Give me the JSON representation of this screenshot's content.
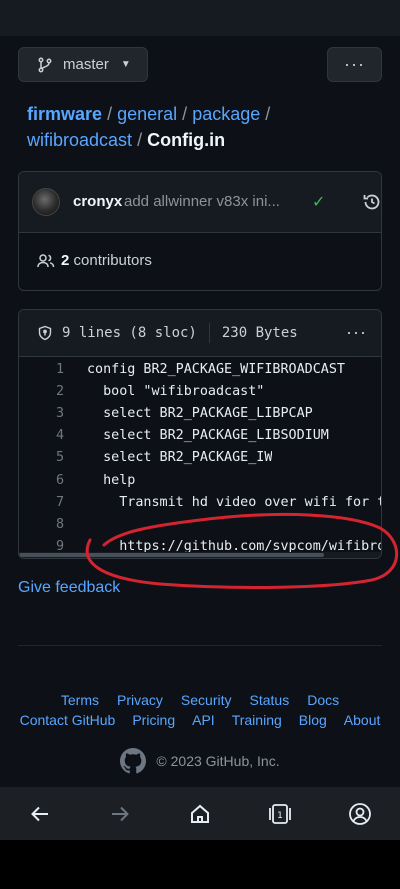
{
  "branch": {
    "name": "master"
  },
  "breadcrumb": {
    "repo": "firmware",
    "dir1": "general",
    "dir2": "package",
    "dir3": "wifibroadcast",
    "file": "Config.in",
    "sep": "/"
  },
  "commit": {
    "author": "cronyx",
    "message": "add allwinner v83x ini...",
    "status": "success"
  },
  "contributors": {
    "count": "2",
    "label": "contributors"
  },
  "file_info": {
    "lines": "9 lines (8 sloc)",
    "size": "230 Bytes"
  },
  "code_lines": [
    {
      "n": "1",
      "text": "config BR2_PACKAGE_WIFIBROADCAST"
    },
    {
      "n": "2",
      "text": "  bool \"wifibroadcast\""
    },
    {
      "n": "3",
      "text": "  select BR2_PACKAGE_LIBPCAP"
    },
    {
      "n": "4",
      "text": "  select BR2_PACKAGE_LIBSODIUM"
    },
    {
      "n": "5",
      "text": "  select BR2_PACKAGE_IW"
    },
    {
      "n": "6",
      "text": "  help"
    },
    {
      "n": "7",
      "text": "    Transmit hd video over wifi for t"
    },
    {
      "n": "8",
      "text": ""
    },
    {
      "n": "9",
      "text": "    https://github.com/svpcom/wifibro"
    }
  ],
  "feedback": {
    "label": "Give feedback"
  },
  "footer": {
    "row1": [
      "Terms",
      "Privacy",
      "Security",
      "Status",
      "Docs"
    ],
    "row2": [
      "Contact GitHub",
      "Pricing",
      "API",
      "Training",
      "Blog",
      "About"
    ],
    "copyright": "© 2023 GitHub, Inc."
  },
  "colors": {
    "background": "#0d1117",
    "link": "#58a6ff",
    "annotation": "#d4242f",
    "success": "#3fb950"
  },
  "icons": {
    "branch": "git-branch-icon",
    "history": "history-icon",
    "people": "people-icon",
    "shield": "shield-icon",
    "logo": "github-mark-icon"
  }
}
